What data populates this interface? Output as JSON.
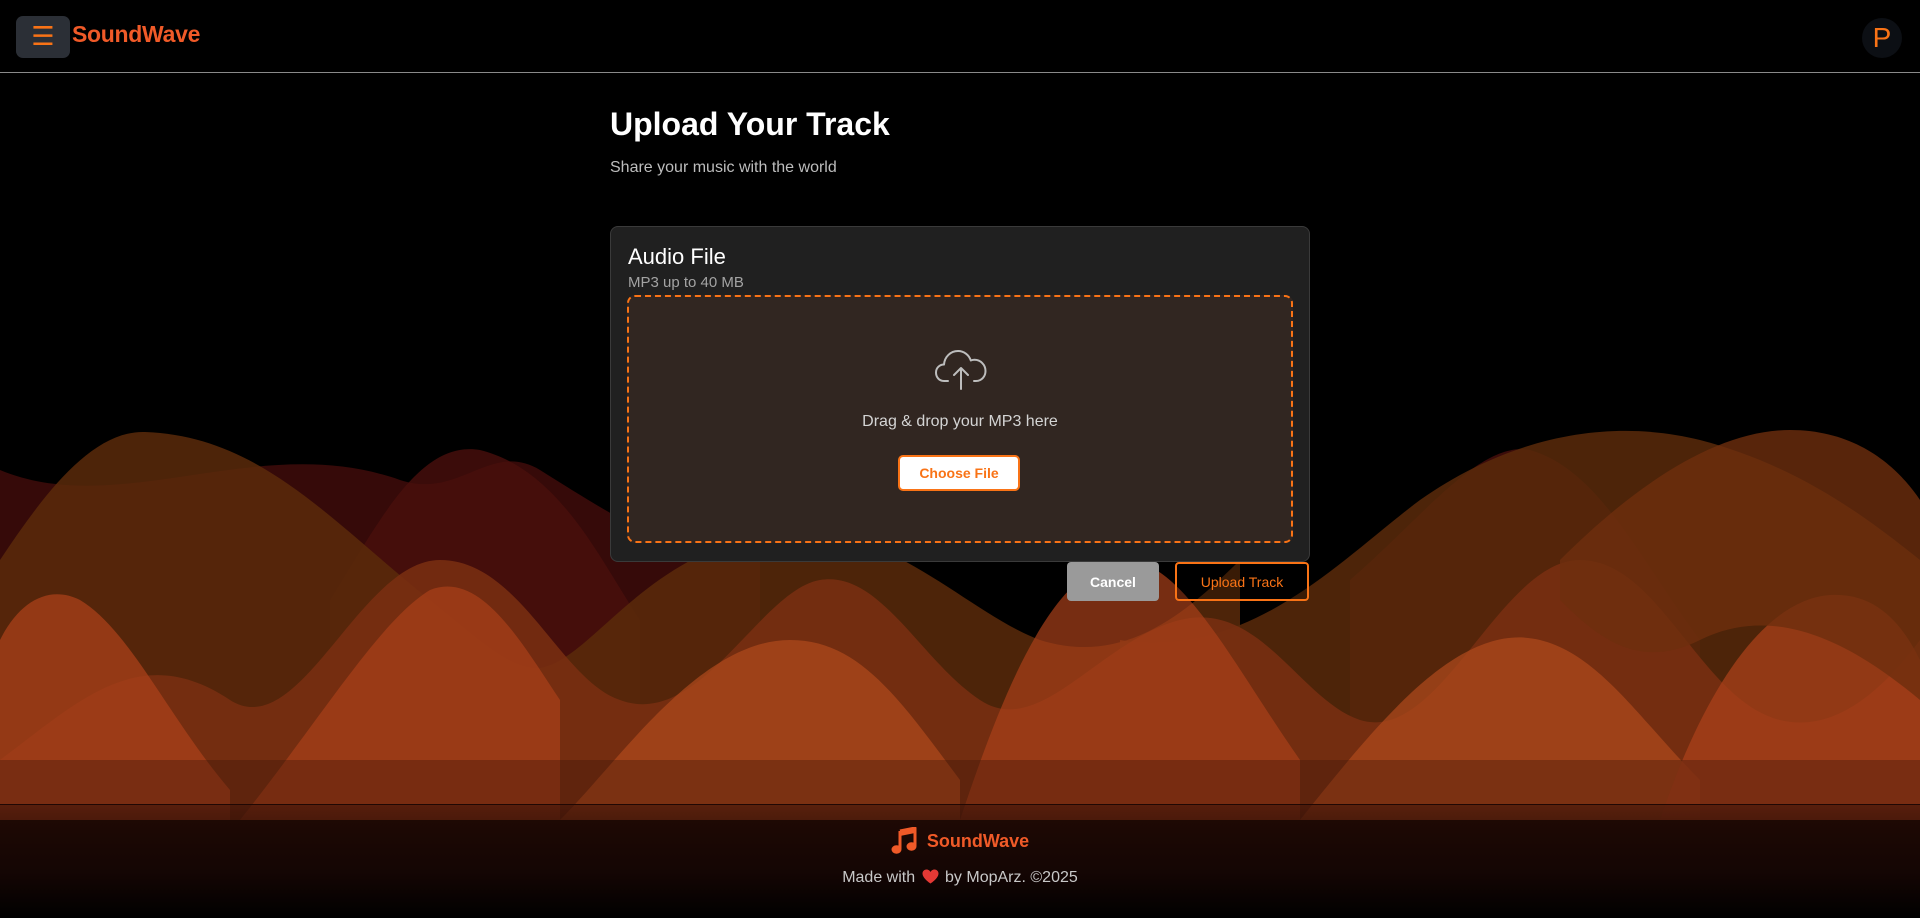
{
  "header": {
    "menu_icon": "☰",
    "brand": "SoundWave",
    "avatar_initial": "P"
  },
  "main": {
    "title": "Upload Your Track",
    "subtitle": "Share your music with the world",
    "card": {
      "title": "Audio File",
      "hint": "MP3 up to 40 MB",
      "dropzone_text": "Drag & drop your MP3 here",
      "choose_label": "Choose File"
    },
    "actions": {
      "cancel_label": "Cancel",
      "upload_label": "Upload Track"
    }
  },
  "footer": {
    "brand": "SoundWave",
    "credit_prefix": "Made with",
    "credit_suffix": "by MopArz. ©2025"
  },
  "colors": {
    "accent": "#f97316",
    "brand": "#f05a28",
    "background": "#000000",
    "card": "#202020",
    "dropzone": "#312621"
  },
  "icons": {
    "menu": "hamburger-icon",
    "upload": "cloud-upload-icon",
    "footer_logo": "music-note-icon",
    "heart": "heart-icon"
  }
}
